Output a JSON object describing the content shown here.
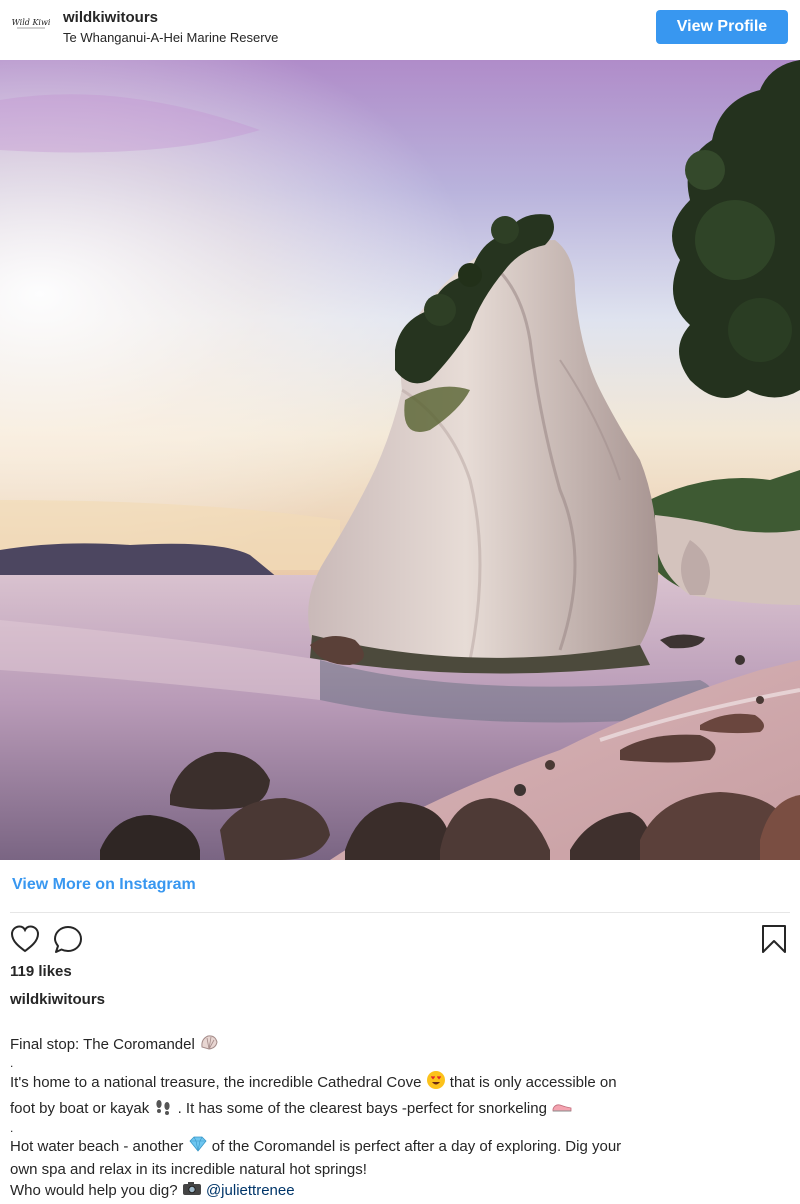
{
  "header": {
    "avatar_text": "Wild Kiwi",
    "username": "wildkiwitours",
    "location": "Te Whanganui-A-Hei Marine Reserve",
    "view_profile_label": "View Profile"
  },
  "post": {
    "image_alt": "Cathedral Cove rock formation at sunset",
    "view_more_label": "View More on Instagram",
    "likes": "119 likes",
    "caption_username": "wildkiwitours",
    "caption": {
      "line1": "Final stop: The Coromandel",
      "dot": ".",
      "line2a": "It's home to a national treasure, the incredible Cathedral Cove",
      "line2b": "that is only accessible on",
      "line3a": "foot by boat or kayak",
      "line3b": ". It has some of the clearest bays -perfect for snorkeling",
      "line4a": "Hot water beach - another",
      "line4b": "of the Coromandel is perfect after a day of exploring. Dig your",
      "line5": "own spa and relax in its incredible natural hot springs!",
      "line6a": "Who would help you dig?",
      "mention": "@juliettrenee"
    }
  },
  "icons": {
    "like": "heart-icon",
    "comment": "comment-icon",
    "save": "bookmark-icon",
    "shell": "shell-emoji",
    "heart_eyes": "heart-eyes-emoji",
    "footprints": "footprints-emoji",
    "shoe": "shoe-emoji",
    "gem": "gem-emoji",
    "camera": "camera-emoji"
  },
  "colors": {
    "accent": "#3897f0",
    "text": "#262626",
    "mention": "#003569"
  }
}
